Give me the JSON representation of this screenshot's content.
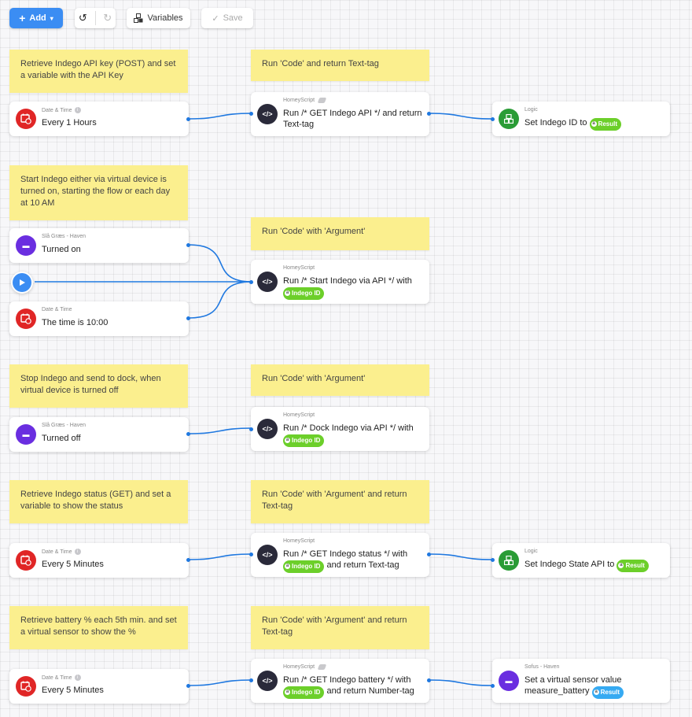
{
  "toolbar": {
    "add_label": "Add",
    "variables_label": "Variables",
    "save_label": "Save"
  },
  "colors": {
    "accent": "#3b8df3",
    "note": "#fbef8e",
    "wire": "#1f78e0",
    "tag_green": "#6ccf2a",
    "tag_blue": "#36aaf2"
  },
  "notes": [
    "Retrieve Indego API key (POST) and set a variable with the API Key",
    "Run 'Code' and return Text-tag",
    "Start Indego either via virtual device is turned on, starting the flow or each day at 10 AM",
    "Run 'Code' with 'Argument'",
    "Stop Indego and send to dock, when virtual device is turned off",
    "Run 'Code' with 'Argument'",
    "Retrieve Indego status (GET) and set a variable to show the status",
    "Run 'Code' with 'Argument' and return Text-tag",
    "Retrieve battery % each 5th min. and set a virtual sensor to show the %",
    "Run 'Code' with 'Argument' and return Text-tag"
  ],
  "cards": [
    {
      "source": "Date & Time",
      "text": "Every 1  Hours",
      "icon": "calendar-clock-icon"
    },
    {
      "source": "HomeyScript",
      "text": "Run /* GET Indego API */ and return Text-tag",
      "icon": "code-icon"
    },
    {
      "source": "Logic",
      "text": "Set Indego ID to",
      "tag": "Result",
      "icon": "logic-icon"
    },
    {
      "source": "Slå Græs - Haven",
      "text": "Turned on",
      "icon": "mower-icon"
    },
    {
      "source": "Date & Time",
      "text": "The time is 10:00",
      "icon": "calendar-clock-icon"
    },
    {
      "source": "HomeyScript",
      "text": "Run /* Start Indego via API */ with",
      "tag": "Indego ID",
      "icon": "code-icon"
    },
    {
      "source": "Slå Græs - Haven",
      "text": "Turned off",
      "icon": "mower-icon"
    },
    {
      "source": "HomeyScript",
      "text": "Run /* Dock Indego via API */ with",
      "tag": "Indego ID",
      "icon": "code-icon"
    },
    {
      "source": "Date & Time",
      "text": "Every 5  Minutes",
      "icon": "calendar-clock-icon"
    },
    {
      "source": "HomeyScript",
      "text": "Run /* GET Indego status */ with",
      "tag": "Indego ID",
      "text_after": "and return Text-tag",
      "icon": "code-icon"
    },
    {
      "source": "Logic",
      "text": "Set Indego State API to",
      "tag": "Result",
      "icon": "logic-icon"
    },
    {
      "source": "Date & Time",
      "text": "Every 5  Minutes",
      "icon": "calendar-clock-icon"
    },
    {
      "source": "HomeyScript",
      "text": "Run /* GET Indego battery */ with",
      "tag": "Indego ID",
      "text_after": "and return Number-tag",
      "icon": "code-icon"
    },
    {
      "source": "Sofus - Haven",
      "text": "Set a virtual sensor value",
      "text2": "measure_battery",
      "tag": "Result",
      "icon": "mower-icon"
    }
  ]
}
